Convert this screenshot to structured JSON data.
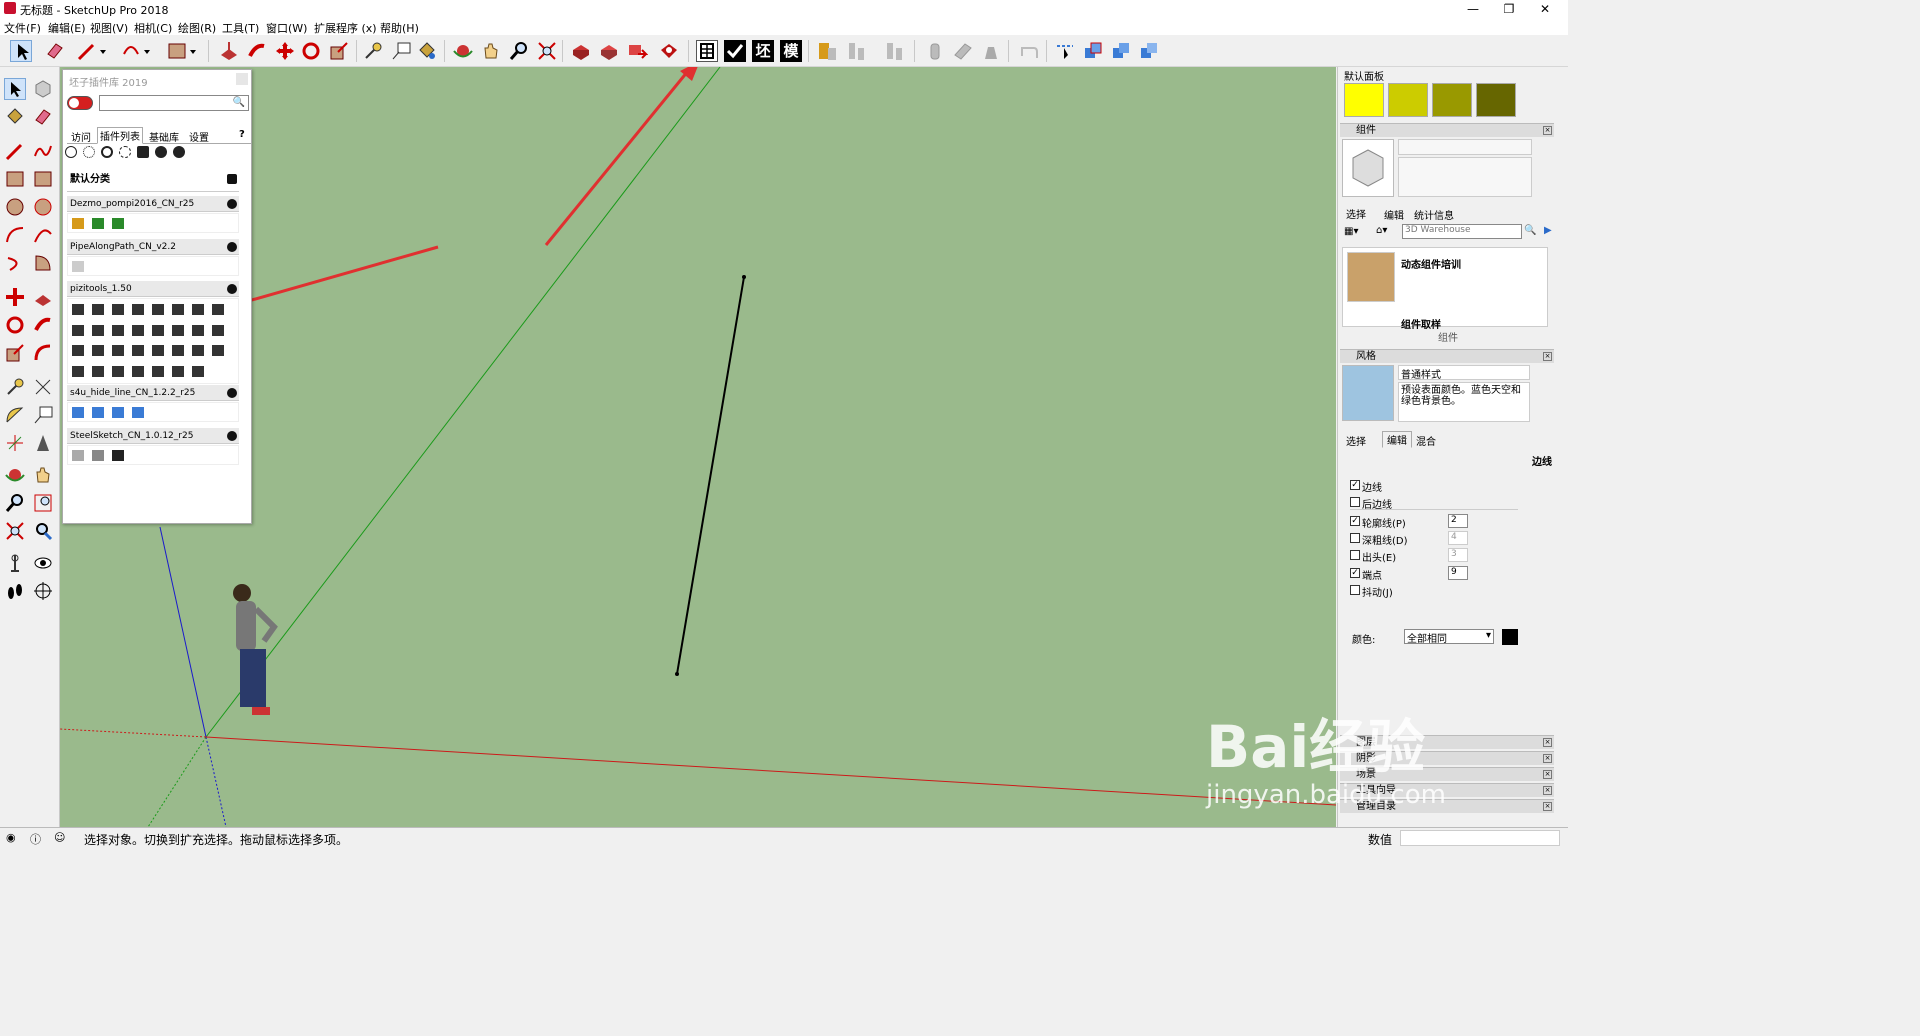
{
  "window": {
    "title": "无标题 - SketchUp Pro 2018",
    "minimize": "—",
    "maximize": "❐",
    "close": "✕"
  },
  "menu": [
    "文件(F)",
    "编辑(E)",
    "视图(V)",
    "相机(C)",
    "绘图(R)",
    "工具(T)",
    "窗口(W)",
    "扩展程序 (x)",
    "帮助(H)"
  ],
  "toolbar_text": {
    "t1": "坯",
    "t2": "模"
  },
  "plugin": {
    "title": "坯子插件库 2019",
    "tabs": [
      "访问",
      "插件列表",
      "基础库",
      "设置"
    ],
    "help": "?",
    "category": "默认分类",
    "plugins": [
      "Dezmo_pompi2016_CN_r25",
      "PipeAlongPath_CN_v2.2",
      "pizitools_1.50",
      "s4u_hide_line_CN_1.2.2_r25",
      "SteelSketch_CN_1.0.12_r25"
    ]
  },
  "right": {
    "panel_title": "默认面板",
    "swatches": [
      "#ffff00",
      "#cccc00",
      "#999900",
      "#666600"
    ],
    "components": {
      "title": "组件",
      "tabs": [
        "选择",
        "编辑",
        "统计信息"
      ],
      "search": "3D Warehouse",
      "item1": "动态组件培训",
      "item2": "组件取样",
      "footer": "组件"
    },
    "styles": {
      "title": "风格",
      "name": "普通样式",
      "desc": "预设表面颜色。蓝色天空和绿色背景色。",
      "tabs": [
        "选择",
        "编辑",
        "混合"
      ],
      "edge_label": "边线",
      "checks": [
        {
          "label": "边线",
          "checked": true,
          "value": ""
        },
        {
          "label": "后边线",
          "checked": false,
          "value": ""
        },
        {
          "label": "轮廓线(P)",
          "checked": true,
          "value": "2"
        },
        {
          "label": "深粗线(D)",
          "checked": false,
          "value": "4"
        },
        {
          "label": "出头(E)",
          "checked": false,
          "value": "3"
        },
        {
          "label": "端点",
          "checked": true,
          "value": "9"
        },
        {
          "label": "抖动(J)",
          "checked": false,
          "value": ""
        }
      ],
      "color_label": "颜色:",
      "color_value": "全部相同"
    },
    "collapsed": [
      "图层",
      "阴影",
      "场景",
      "工具向导",
      "管理目录"
    ]
  },
  "status": {
    "text": "选择对象。切换到扩充选择。拖动鼠标选择多项。",
    "measure": "数值"
  },
  "watermark": {
    "big": "Bai经验",
    "small": "jingyan.baidu.com"
  }
}
